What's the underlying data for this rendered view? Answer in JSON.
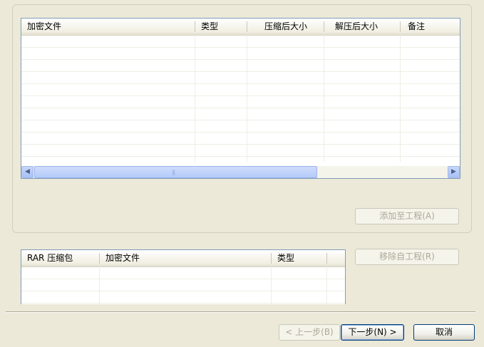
{
  "top_table": {
    "columns": [
      "加密文件",
      "类型",
      "压缩后大小",
      "解压后大小",
      "备注"
    ],
    "rows": []
  },
  "bottom_table": {
    "columns": [
      "RAR 压缩包",
      "加密文件",
      "类型"
    ],
    "rows": []
  },
  "buttons": {
    "add_to_project": "添加至工程(A)",
    "remove_from_project": "移除自工程(R)",
    "back": "< 上一步(B)",
    "next": "下一步(N) >",
    "cancel": "取消"
  },
  "scrollbar": {
    "left_arrow_icon": "arrow-left-icon",
    "right_arrow_icon": "arrow-right-icon",
    "thumb_grip": "|||"
  }
}
